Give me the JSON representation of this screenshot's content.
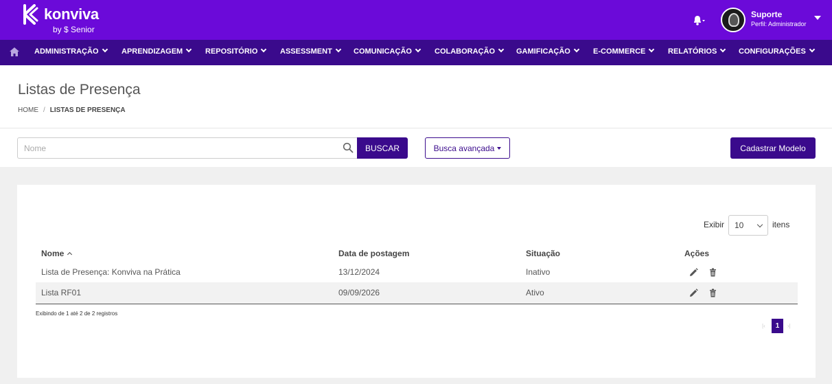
{
  "brand": {
    "name": "konviva",
    "sub": "by $ Senior"
  },
  "user": {
    "name": "Suporte",
    "role": "Perfil: Administrador"
  },
  "nav": {
    "items": [
      {
        "label": "ADMINISTRAÇÃO"
      },
      {
        "label": "APRENDIZAGEM"
      },
      {
        "label": "REPOSITÓRIO"
      },
      {
        "label": "ASSESSMENT"
      },
      {
        "label": "COMUNICAÇÃO"
      },
      {
        "label": "COLABORAÇÃO"
      },
      {
        "label": "GAMIFICAÇÃO"
      },
      {
        "label": "E-COMMERCE"
      },
      {
        "label": "RELATÓRIOS"
      },
      {
        "label": "CONFIGURAÇÕES"
      }
    ]
  },
  "page": {
    "title": "Listas de Presença",
    "breadcrumb": {
      "home": "HOME",
      "sep": "/",
      "current": "LISTAS DE PRESENÇA"
    }
  },
  "search": {
    "placeholder": "Nome",
    "value": "",
    "button": "BUSCAR",
    "advanced": "Busca avançada"
  },
  "actions": {
    "register": "Cadastrar Modelo"
  },
  "pagesize": {
    "label_before": "Exibir",
    "value": "10",
    "label_after": "itens"
  },
  "table": {
    "headers": {
      "name": "Nome",
      "date": "Data de postagem",
      "status": "Situação",
      "actions": "Ações"
    },
    "rows": [
      {
        "name": "Lista de Presença: Konviva na Prática",
        "date": "13/12/2024",
        "status": "Inativo"
      },
      {
        "name": "Lista RF01",
        "date": "09/09/2026",
        "status": "Ativo"
      }
    ]
  },
  "footer": {
    "info": "Exibindo de 1 até 2 de 2 registros",
    "page_current": "1",
    "first": "|‹",
    "last": "›|"
  },
  "colors": {
    "header": "#6b0ad9",
    "nav": "#3a0a8c",
    "accent": "#3a0a8c"
  }
}
